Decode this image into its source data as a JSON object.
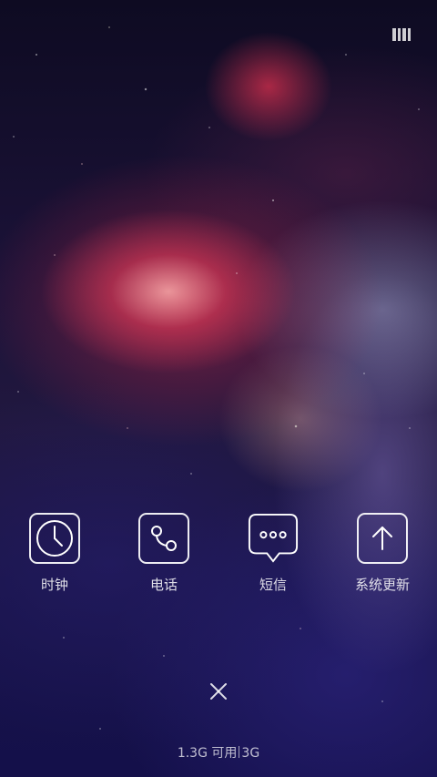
{
  "top_bar": {
    "recents_icon": "recent-apps-icon"
  },
  "shortcuts": [
    {
      "label": "时钟",
      "icon": "clock-icon"
    },
    {
      "label": "电话",
      "icon": "phone-icon"
    },
    {
      "label": "短信",
      "icon": "message-icon"
    },
    {
      "label": "系统更新",
      "icon": "update-arrow-icon"
    }
  ],
  "footer": {
    "close_icon": "close-icon",
    "memory_available": "1.3G 可用",
    "memory_total": "3G"
  }
}
